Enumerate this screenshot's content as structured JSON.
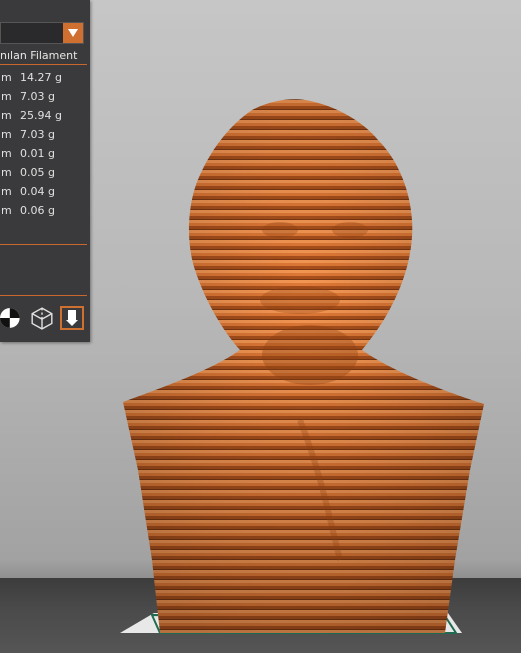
{
  "materials": {
    "dropdown_value": "",
    "column_header": "nılan Filament",
    "rows": [
      {
        "unit": "m",
        "weight": "14.27 g"
      },
      {
        "unit": "m",
        "weight": "7.03 g"
      },
      {
        "unit": "m",
        "weight": "25.94 g"
      },
      {
        "unit": "m",
        "weight": "7.03 g"
      },
      {
        "unit": "m",
        "weight": "0.01 g"
      },
      {
        "unit": "m",
        "weight": "0.05 g"
      },
      {
        "unit": "m",
        "weight": "0.04 g"
      },
      {
        "unit": "m",
        "weight": "0.06 g"
      }
    ]
  },
  "view_icons": [
    "view-mode-icon",
    "wireframe-cube-icon",
    "extruder-icon"
  ],
  "colors": {
    "panel_bg": "#3a3a3c",
    "accent_orange": "#d07030",
    "model_orange": "#d9732f",
    "bed_outline": "#1f6b52"
  }
}
